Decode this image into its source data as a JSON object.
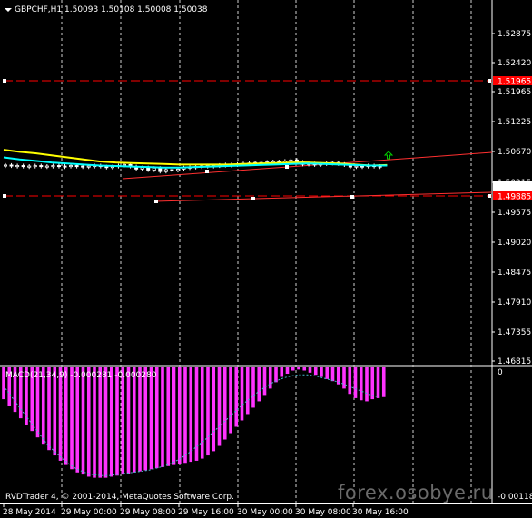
{
  "header": {
    "symbol": "GBPCHF,H1",
    "ohlc": "1.50093 1.50108 1.50008 1.50038"
  },
  "macd_header": "MACD(21,34,9) -0.000281 -0.000280",
  "copyright": "RVDTrader 4, © 2001-2014, MetaQuotes Software Corp.",
  "watermark": "forex.osobye.ru",
  "colors": {
    "background": "#000000",
    "bull_candle": "#ffffff",
    "bear_candle": "#ffffff",
    "level_line": "#ff0000",
    "channel_line": "#ff3030",
    "ma_fast": "#ffff00",
    "ma_slow": "#00ffff",
    "macd_hist": "#ff33ff",
    "macd_signal": "#44bbcc",
    "current_price_bg": "#ffffff",
    "level_label_bg": "#ff0000",
    "arrow": "#00cc00"
  },
  "chart_data": [
    {
      "type": "candlestick",
      "title": "GBPCHF,H1",
      "ylim": [
        1.4617,
        1.5318
      ],
      "y_ticks": [
        "1.52875",
        "1.52420",
        "1.51965",
        "1.51225",
        "1.50670",
        "1.50215",
        "1.49575",
        "1.49020",
        "1.48475",
        "1.47910",
        "1.47355",
        "1.46815"
      ],
      "x_ticks": [
        "28 May 2014",
        "29 May 00:00",
        "29 May 08:00",
        "29 May 16:00",
        "30 May 00:00",
        "30 May 08:00",
        "30 May 16:00"
      ],
      "price_labels": [
        {
          "name": "resistance",
          "value": "1.51965",
          "style": "red"
        },
        {
          "name": "current",
          "value": "1.50038",
          "style": "white"
        },
        {
          "name": "support",
          "value": "1.49885",
          "style": "red"
        }
      ],
      "horizontal_levels": [
        1.51965,
        1.49885
      ],
      "channel": {
        "upper_start": 1.5002,
        "upper_end": 1.5068,
        "lower_start": 1.4975,
        "lower_end": 1.4988
      },
      "series": [
        {
          "name": "price",
          "values": [
            1.5007,
            1.5005,
            1.5006,
            1.5004,
            1.5005,
            1.5006,
            1.5004,
            1.5005,
            1.5006,
            1.5005,
            1.5004,
            1.5006,
            1.5005,
            1.5004,
            1.5005,
            1.5006,
            1.5004,
            1.5002,
            1.5004,
            1.5006,
            1.5008,
            1.5004,
            1.4999,
            1.5002,
            1.4997,
            1.5001,
            1.4994,
            1.4998,
            1.4996,
            1.4999,
            1.5002,
            1.5003,
            1.5004,
            1.5005,
            1.5006,
            1.5005,
            1.5007,
            1.5008,
            1.5007,
            1.5009,
            1.501,
            1.5011,
            1.5012,
            1.501,
            1.5013,
            1.5014,
            1.5012,
            1.5015,
            1.5017,
            1.5013,
            1.5008,
            1.501,
            1.5007,
            1.5009,
            1.5011,
            1.5012,
            1.5009,
            1.5007,
            1.5003,
            1.5005,
            1.5004,
            1.5006,
            1.5005,
            1.5004
          ]
        },
        {
          "name": "ma_fast",
          "values": [
            1.5037,
            1.5033,
            1.503,
            1.5026,
            1.5022,
            1.5018,
            1.5014,
            1.5012,
            1.5011,
            1.501,
            1.5009,
            1.5008,
            1.5008,
            1.5008,
            1.5008,
            1.5009,
            1.501,
            1.5011,
            1.5012,
            1.5012,
            1.5011,
            1.501,
            1.5008,
            1.5006,
            1.5007
          ]
        },
        {
          "name": "ma_slow",
          "values": [
            1.5022,
            1.5018,
            1.5015,
            1.5012,
            1.501,
            1.5008,
            1.5006,
            1.5005,
            1.5004,
            1.5003,
            1.5002,
            1.5002,
            1.5003,
            1.5004,
            1.5005,
            1.5006,
            1.5007,
            1.5008,
            1.5009,
            1.501,
            1.5009,
            1.5008,
            1.5007,
            1.5006,
            1.5006
          ]
        }
      ],
      "arrow_up_at": 1.5065
    },
    {
      "type": "bar",
      "title": "MACD(21,34,9) -0.000281 -0.000280",
      "ylim": [
        -0.00118,
        0
      ],
      "y_ticks": [
        "0",
        "-0.001181"
      ],
      "series": [
        {
          "name": "macd",
          "values": [
            -0.0003,
            -0.00036,
            -0.00042,
            -0.00048,
            -0.00054,
            -0.0006,
            -0.00066,
            -0.00072,
            -0.00078,
            -0.00083,
            -0.00088,
            -0.00092,
            -0.00096,
            -0.00099,
            -0.00101,
            -0.00103,
            -0.00104,
            -0.00104,
            -0.00104,
            -0.00103,
            -0.00102,
            -0.00101,
            -0.001,
            -0.00099,
            -0.00098,
            -0.00097,
            -0.00096,
            -0.00095,
            -0.00094,
            -0.00093,
            -0.00092,
            -0.00091,
            -0.0009,
            -0.00089,
            -0.00088,
            -0.00086,
            -0.00083,
            -0.00079,
            -0.00074,
            -0.00068,
            -0.00062,
            -0.00056,
            -0.0005,
            -0.00044,
            -0.00038,
            -0.00032,
            -0.00026,
            -0.0002,
            -0.00014,
            -9e-05,
            -6e-05,
            -3e-05,
            -2e-05,
            -3e-05,
            -5e-05,
            -7e-05,
            -9e-05,
            -0.00011,
            -0.00013,
            -0.00016,
            -0.0002,
            -0.00025,
            -0.00029,
            -0.00031,
            -0.00032,
            -0.0003,
            -0.00029,
            -0.00028
          ]
        },
        {
          "name": "signal",
          "values": [
            -0.0002,
            -0.0003,
            -0.0004,
            -0.0005,
            -0.0006,
            -0.0007,
            -0.00078,
            -0.00085,
            -0.00091,
            -0.00096,
            -0.00099,
            -0.00101,
            -0.00102,
            -0.00102,
            -0.00101,
            -0.001,
            -0.00099,
            -0.00098,
            -0.00097,
            -0.00095,
            -0.00093,
            -0.0009,
            -0.00086,
            -0.00081,
            -0.00075,
            -0.00069,
            -0.00062,
            -0.00055,
            -0.00048,
            -0.00041,
            -0.00034,
            -0.00028,
            -0.00022,
            -0.00017,
            -0.00013,
            -0.0001,
            -8e-05,
            -7e-05,
            -7e-05,
            -8e-05,
            -0.0001,
            -0.00012,
            -0.00014,
            -0.00017,
            -0.0002,
            -0.00023,
            -0.00026,
            -0.00028
          ]
        }
      ]
    }
  ]
}
